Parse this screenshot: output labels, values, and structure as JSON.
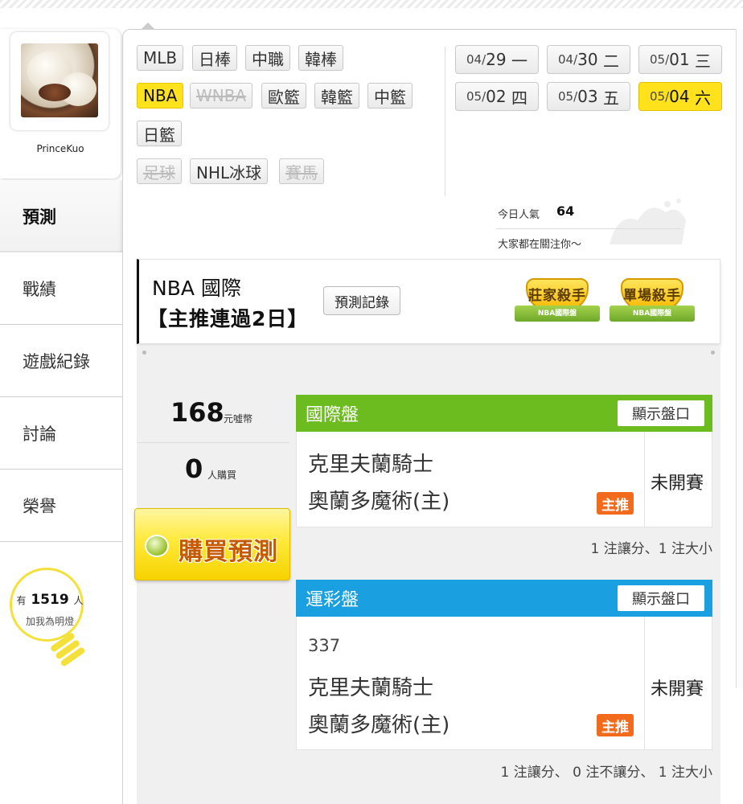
{
  "profile": {
    "username": "PrinceKuo"
  },
  "nav": {
    "items": [
      "預測",
      "戰績",
      "遊戲紀錄",
      "討論",
      "榮譽"
    ],
    "active_index": 0
  },
  "lightbulb": {
    "prefix": "有",
    "count": "1519",
    "suffix": "人",
    "subtext": "加我為明燈"
  },
  "sports": {
    "row1": [
      {
        "label": "MLB"
      },
      {
        "label": "日棒"
      },
      {
        "label": "中職"
      },
      {
        "label": "韓棒"
      }
    ],
    "row2": [
      {
        "label": "NBA",
        "selected": true
      },
      {
        "label": "WNBA",
        "disabled": true
      },
      {
        "label": "歐籃"
      },
      {
        "label": "韓籃"
      },
      {
        "label": "中籃"
      }
    ],
    "row3": [
      {
        "label": "日籃"
      }
    ],
    "row4": [
      {
        "label": "足球",
        "disabled": true
      },
      {
        "label": "NHL冰球"
      },
      {
        "label": "賽馬",
        "disabled": true
      }
    ]
  },
  "dates": [
    {
      "md": "04/",
      "day": "29",
      "dow": "一"
    },
    {
      "md": "04/",
      "day": "30",
      "dow": "二"
    },
    {
      "md": "05/",
      "day": "01",
      "dow": "三"
    },
    {
      "md": "05/",
      "day": "02",
      "dow": "四"
    },
    {
      "md": "05/",
      "day": "03",
      "dow": "五"
    },
    {
      "md": "05/",
      "day": "04",
      "dow": "六",
      "selected": true
    }
  ],
  "popularity": {
    "label": "今日人氣",
    "value": "64",
    "subtitle": "大家都在關注你～"
  },
  "prediction_header": {
    "title": "NBA 國際",
    "streak": "【主推連過2日】",
    "record_button": "預測記錄",
    "badges": [
      {
        "title": "莊家殺手",
        "ribbon": "NBA國際盤"
      },
      {
        "title": "單場殺手",
        "ribbon": "NBA國際盤"
      }
    ]
  },
  "purchase": {
    "price": "168",
    "price_unit": "元噓幣",
    "buyers": "0",
    "buyers_unit": "人購買",
    "buy_button": "購買預測"
  },
  "bets": [
    {
      "title": "國際盤",
      "color": "#6cbb1f",
      "show_button": "顯示盤口",
      "game_number": "",
      "team1": "克里夫蘭騎士",
      "team2": "奧蘭多魔術(主)",
      "tag": "主推",
      "status": "未開賽",
      "summary": "1 注讓分、1 注大小"
    },
    {
      "title": "運彩盤",
      "color": "#1a9fe0",
      "show_button": "顯示盤口",
      "game_number": "337",
      "team1": "克里夫蘭騎士",
      "team2": "奧蘭多魔術(主)",
      "tag": "主推",
      "status": "未開賽",
      "summary": "1 注讓分、 0 注不讓分、 1 注大小"
    }
  ]
}
